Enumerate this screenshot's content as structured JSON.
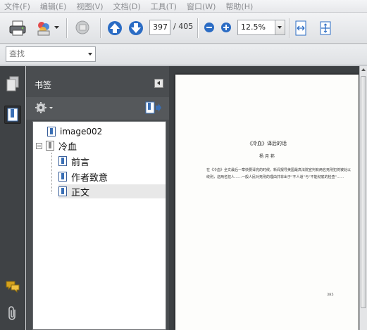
{
  "menu": [
    "文件(F)",
    "编辑(E)",
    "视图(V)",
    "文档(D)",
    "工具(T)",
    "窗口(W)",
    "帮助(H)"
  ],
  "toolbar": {
    "page_current": "397",
    "page_total": "/ 405",
    "zoom": "12.5%"
  },
  "search": {
    "placeholder": "查找"
  },
  "bookmarks_panel": {
    "title": "书签",
    "items": [
      {
        "label": "image002",
        "level": 1
      },
      {
        "label": "冷血",
        "level": 1,
        "expanded": true
      },
      {
        "label": "前言",
        "level": 2
      },
      {
        "label": "作者致意",
        "level": 2
      },
      {
        "label": "正文",
        "level": 2,
        "selected": true
      }
    ]
  },
  "document": {
    "heading": "《冷血》译后的话",
    "author": "杨 月 荪",
    "body": "在《冷血》全文最后一章快要译完的时候，新闻报导美国最高法院宣判有两名死刑犯将被处以绞刑，这两名犯人……一般人民对死刑的理由并非出于“不人道”与“不能彻底的检查”……",
    "page_number": "385"
  },
  "colors": {
    "panel_bg": "#4a4d50",
    "rail_bg": "#3f4245",
    "doc_bg": "#3d4043",
    "accent_blue": "#2b6cc4"
  }
}
